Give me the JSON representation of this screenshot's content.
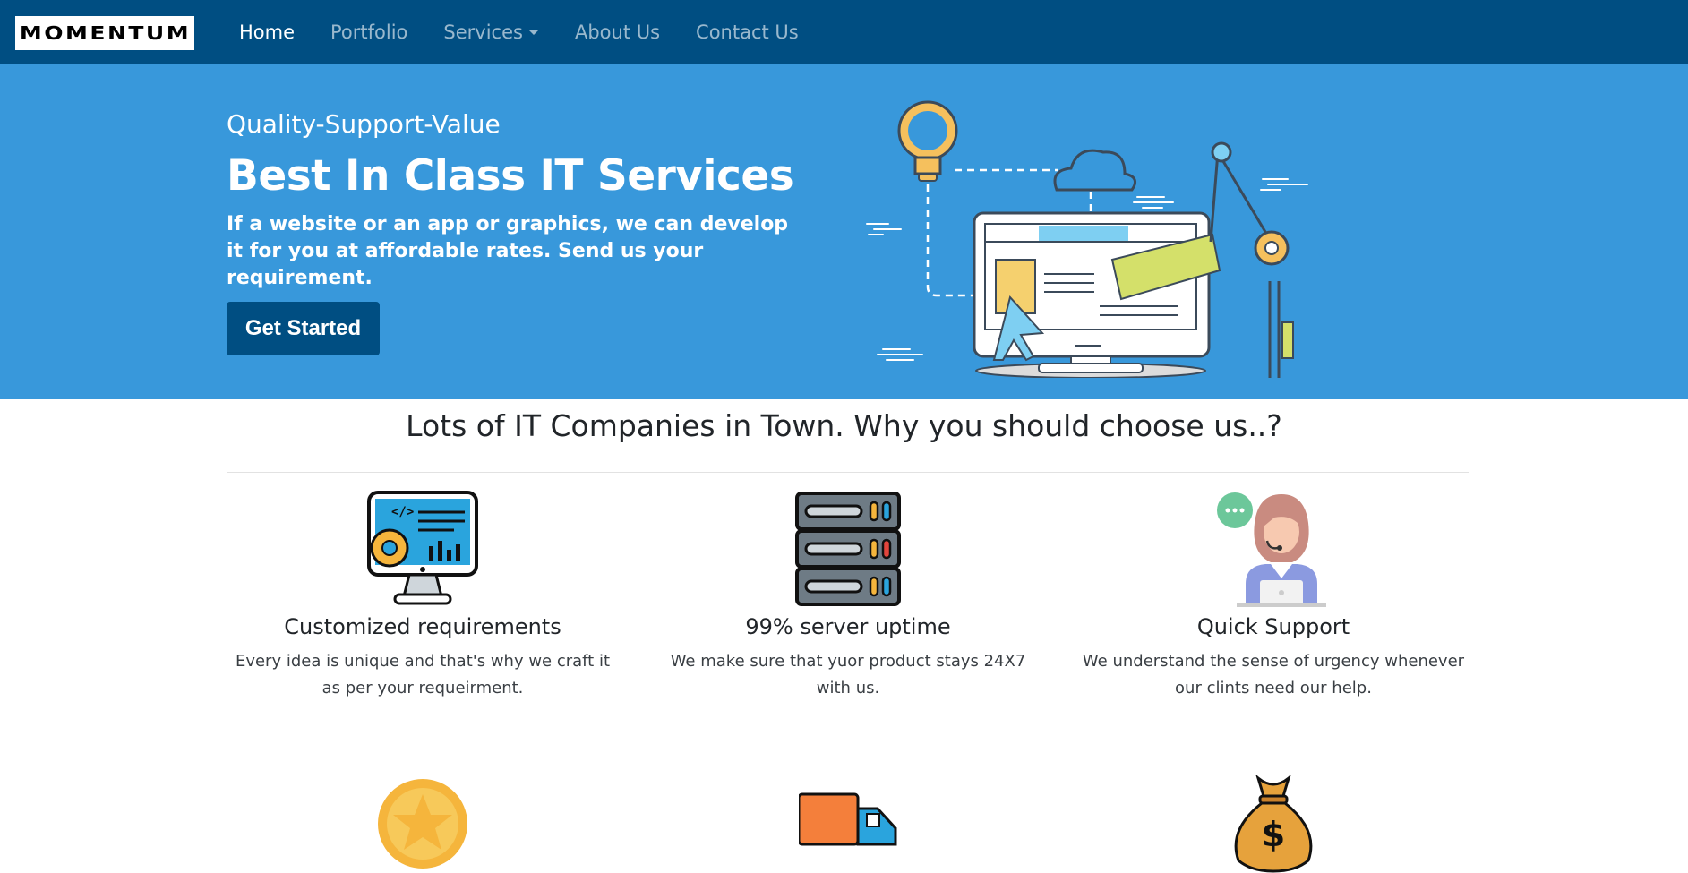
{
  "brand": {
    "logo_text": "MOMENTUM"
  },
  "nav": {
    "items": [
      {
        "label": "Home",
        "active": true
      },
      {
        "label": "Portfolio",
        "active": false
      },
      {
        "label": "Services",
        "active": false,
        "dropdown": true
      },
      {
        "label": "About Us",
        "active": false
      },
      {
        "label": "Contact Us",
        "active": false
      }
    ]
  },
  "hero": {
    "tagline": "Quality-Support-Value",
    "headline": "Best In Class IT Services",
    "description": "If a website or an app or graphics, we can develop it for you at affordable rates. Send us your requirement.",
    "cta_label": "Get Started",
    "illustration_icon": "computer-lightbulb-cloud-illustration"
  },
  "section": {
    "title": "Lots of IT Companies in Town. Why you should choose us..?"
  },
  "features": [
    {
      "icon": "monitor-code-gear-icon",
      "title": "Customized requirements",
      "text": "Every idea is unique and that's why we craft it as per your requeirment."
    },
    {
      "icon": "server-rack-icon",
      "title": "99% server uptime",
      "text": "We make sure that yuor product stays 24X7 with us."
    },
    {
      "icon": "support-agent-icon",
      "title": "Quick Support",
      "text": "We understand the sense of urgency whenever our clints need our help."
    }
  ],
  "features_row2": [
    {
      "icon": "star-medal-icon"
    },
    {
      "icon": "delivery-truck-icon"
    },
    {
      "icon": "money-bag-icon"
    }
  ],
  "colors": {
    "navbar": "#004e82",
    "hero": "#3898db",
    "cta": "#004e82"
  }
}
